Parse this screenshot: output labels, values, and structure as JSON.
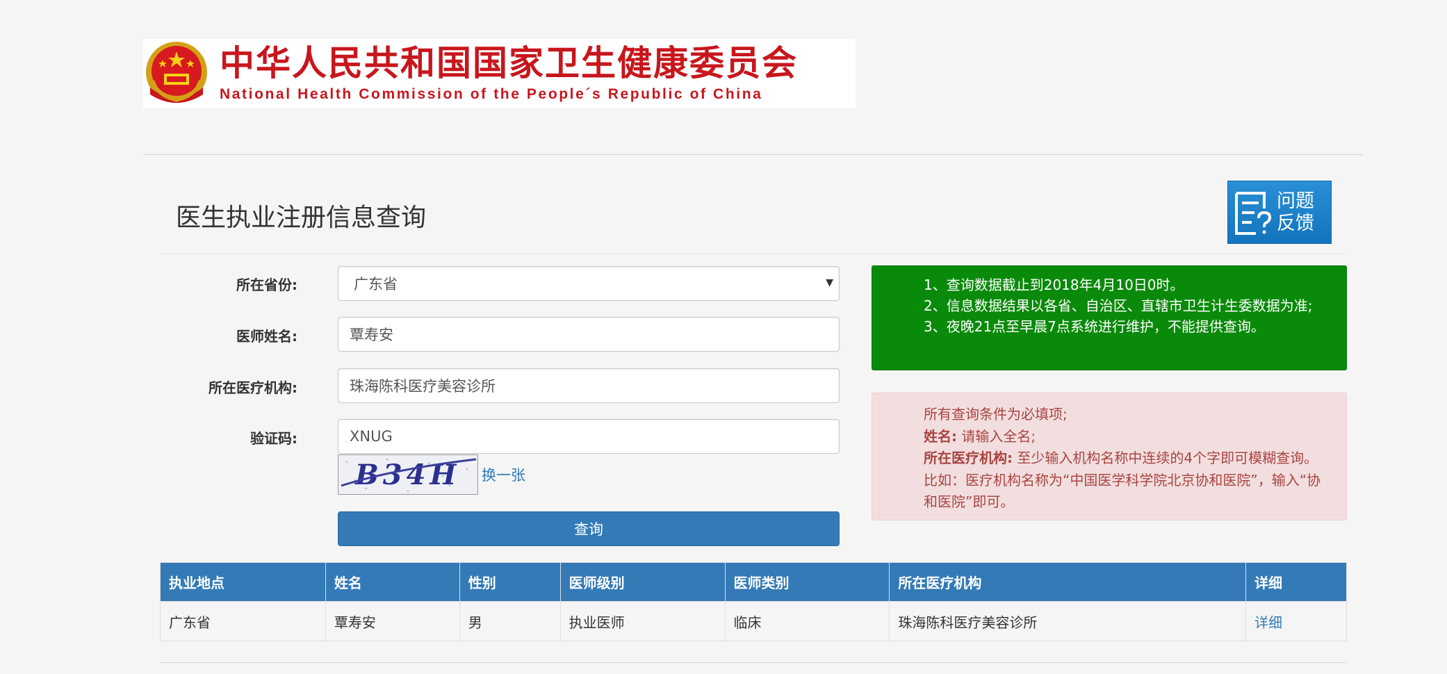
{
  "header": {
    "title_cn": "中华人民共和国国家卫生健康委员会",
    "title_en": "National Health Commission of the People´s Republic of China",
    "logo_icon": "national-emblem-icon"
  },
  "page": {
    "title": "医生执业注册信息查询"
  },
  "feedback": {
    "label_line1": "问题",
    "label_line2": "反馈",
    "icon": "document-question-icon"
  },
  "form": {
    "province_label": "所在省份:",
    "province_value": "广东省",
    "name_label": "医师姓名:",
    "name_value": "覃寿安",
    "org_label": "所在医疗机构:",
    "org_value": "珠海陈科医疗美容诊所",
    "captcha_label": "验证码:",
    "captcha_value": "XNUG",
    "captcha_image_text": "B34H",
    "captcha_refresh": "换一张",
    "submit_label": "查询"
  },
  "notice_green": {
    "line1": "1、查询数据截止到2018年4月10日0时。",
    "line2": "2、信息数据结果以各省、自治区、直辖市卫生计生委数据为准;",
    "line3": "3、夜晚21点至早晨7点系统进行维护，不能提供查询。"
  },
  "notice_red": {
    "line1": "所有查询条件为必填项;",
    "name_key": "姓名:",
    "name_text": "请输入全名;",
    "org_key": "所在医疗机构:",
    "org_text": "至少输入机构名称中连续的4个字即可模糊查询。比如：医疗机构名称为“中国医学科学院北京协和医院”，输入“协和医院”即可。"
  },
  "table": {
    "headers": [
      "执业地点",
      "姓名",
      "性别",
      "医师级别",
      "医师类别",
      "所在医疗机构",
      "详细"
    ],
    "rows": [
      [
        "广东省",
        "覃寿安",
        "男",
        "执业医师",
        "临床",
        "珠海陈科医疗美容诊所",
        "详细"
      ]
    ]
  },
  "colors": {
    "primary": "#337ab7",
    "success_bg": "#0a8a0a",
    "danger_bg": "#f2dede",
    "danger_text": "#a94442",
    "brand_red": "#c8161d"
  }
}
